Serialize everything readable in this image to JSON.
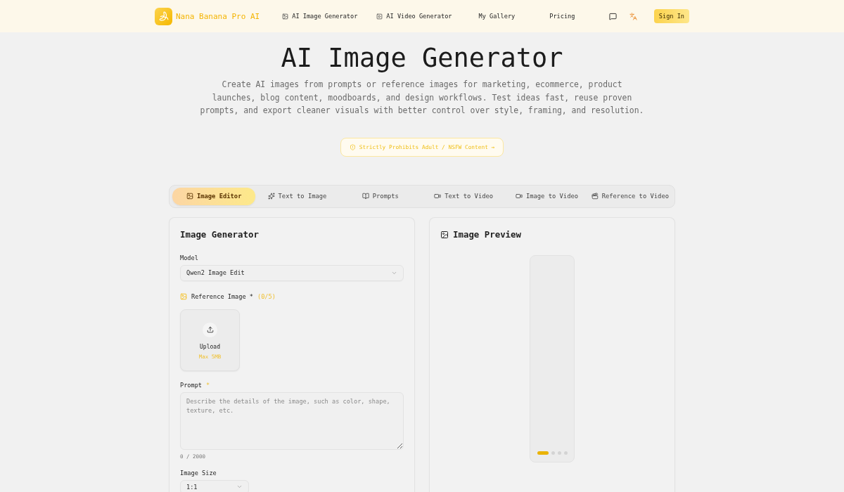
{
  "header": {
    "brand": "Nana Banana Pro AI",
    "nav": [
      {
        "label": "AI Image Generator",
        "kind": "image"
      },
      {
        "label": "AI Video Generator",
        "kind": "video"
      },
      {
        "label": "My Gallery",
        "kind": "plain"
      },
      {
        "label": "Pricing",
        "kind": "plain"
      }
    ],
    "sign_in": "Sign In"
  },
  "hero": {
    "title": "AI Image Generator",
    "description": "Create AI images from prompts or reference images for marketing, ecommerce, product launches, blog content, moodboards, and design workflows. Test ideas fast, reuse proven prompts, and export cleaner visuals with better control over style, framing, and resolution.",
    "notice": "Strictly Prohibits Adult / NSFW Content →"
  },
  "tabs": [
    {
      "label": "Image Editor",
      "kind": "image",
      "selected": true
    },
    {
      "label": "Text to Image",
      "kind": "sparkles",
      "selected": false
    },
    {
      "label": "Prompts",
      "kind": "book",
      "selected": false
    },
    {
      "label": "Text to Video",
      "kind": "video",
      "selected": false
    },
    {
      "label": "Image to Video",
      "kind": "video",
      "selected": false
    },
    {
      "label": "Reference to Video",
      "kind": "clapper",
      "selected": false
    }
  ],
  "generator": {
    "title": "Image Generator",
    "model": {
      "label": "Model",
      "value": "Qwen2 Image Edit"
    },
    "reference": {
      "label": "Reference Image *",
      "count": "(0/5)",
      "upload": "Upload",
      "limit": "Max 5MB"
    },
    "prompt": {
      "label": "Prompt",
      "required": "*",
      "placeholder": "Describe the details of the image, such as color, shape, texture, etc.",
      "counter": "0 / 2000"
    },
    "size": {
      "label": "Image Size",
      "value": "1:1"
    }
  },
  "preview": {
    "title": "Image Preview",
    "slides": [
      {
        "selected": true
      },
      {
        "selected": false
      },
      {
        "selected": false
      },
      {
        "selected": false
      }
    ]
  }
}
